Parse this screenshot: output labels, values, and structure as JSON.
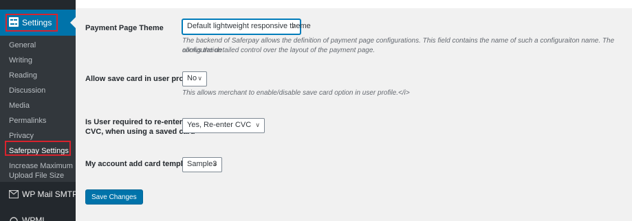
{
  "sidebar": {
    "parent_label": "Settings",
    "items": [
      {
        "label": "General"
      },
      {
        "label": "Writing"
      },
      {
        "label": "Reading"
      },
      {
        "label": "Discussion"
      },
      {
        "label": "Media"
      },
      {
        "label": "Permalinks"
      },
      {
        "label": "Privacy"
      },
      {
        "label": "Saferpay Settings"
      },
      {
        "label": "Increase Maximum"
      },
      {
        "label": "Upload File Size"
      }
    ],
    "bottom_items": [
      {
        "label": "WP Mail SMTP",
        "icon": "mail-icon"
      },
      {
        "label": "WPML",
        "icon": "wpml-icon"
      }
    ]
  },
  "form": {
    "theme": {
      "label": "Payment Page Theme",
      "value": "Default lightweight responsive theme",
      "desc_line1": "The backend of Saferpay allows the definition of payment page configurations. This field contains the name of such a configuraiton name. The configuration",
      "desc_line2": "allows the detailed control over the layout of the payment page."
    },
    "save_card": {
      "label": "Allow save card in user profile",
      "value": "No",
      "desc": "This allows merchant to enable/disable save card option in user profile.</i>"
    },
    "reenter_cvc": {
      "label_line1": "Is User required to re-enter his",
      "label_line2": "CVC, when using a saved card",
      "value": "Yes, Re-enter CVC"
    },
    "card_template": {
      "label": "My account add card template",
      "value": "Sample3"
    },
    "save_label": "Save Changes"
  },
  "colors": {
    "sidebar_bg": "#23282d",
    "submenu_bg": "#32373c",
    "accent": "#0073aa",
    "highlight_box": "#d9232d"
  }
}
